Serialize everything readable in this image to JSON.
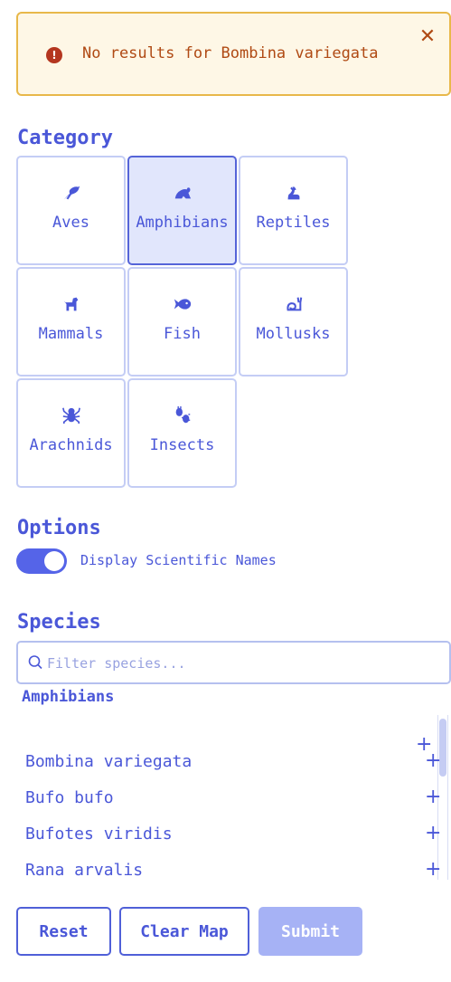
{
  "alert": {
    "icon": "exclamation-circle-icon",
    "message": "No results for Bombina variegata",
    "close_icon": "close-icon"
  },
  "category": {
    "title": "Category",
    "items": [
      {
        "label": "Aves",
        "icon": "bird-icon",
        "selected": false
      },
      {
        "label": "Amphibians",
        "icon": "frog-icon",
        "selected": true
      },
      {
        "label": "Reptiles",
        "icon": "snake-icon",
        "selected": false
      },
      {
        "label": "Mammals",
        "icon": "dog-icon",
        "selected": false
      },
      {
        "label": "Fish",
        "icon": "fish-icon",
        "selected": false
      },
      {
        "label": "Mollusks",
        "icon": "snail-icon",
        "selected": false
      },
      {
        "label": "Arachnids",
        "icon": "spider-icon",
        "selected": false
      },
      {
        "label": "Insects",
        "icon": "bugs-icon",
        "selected": false
      }
    ]
  },
  "options": {
    "title": "Options",
    "toggle_label": "Display Scientific Names",
    "toggle_on": true
  },
  "species": {
    "title": "Species",
    "search_placeholder": "Filter species...",
    "search_value": "",
    "group_label": "Amphibians",
    "items": [
      {
        "name": "Bombina variegata"
      },
      {
        "name": "Bufo bufo"
      },
      {
        "name": "Bufotes viridis"
      },
      {
        "name": "Rana arvalis"
      }
    ],
    "add_symbol": "+"
  },
  "buttons": {
    "reset": "Reset",
    "clear_map": "Clear Map",
    "submit": "Submit"
  },
  "colors": {
    "accent": "#4a57d8",
    "alert_bg": "#fef7e6",
    "alert_border": "#e8b84a",
    "alert_text": "#b04a14",
    "selected_bg": "#e1e6fc",
    "submit_disabled": "#a6b2f5"
  }
}
